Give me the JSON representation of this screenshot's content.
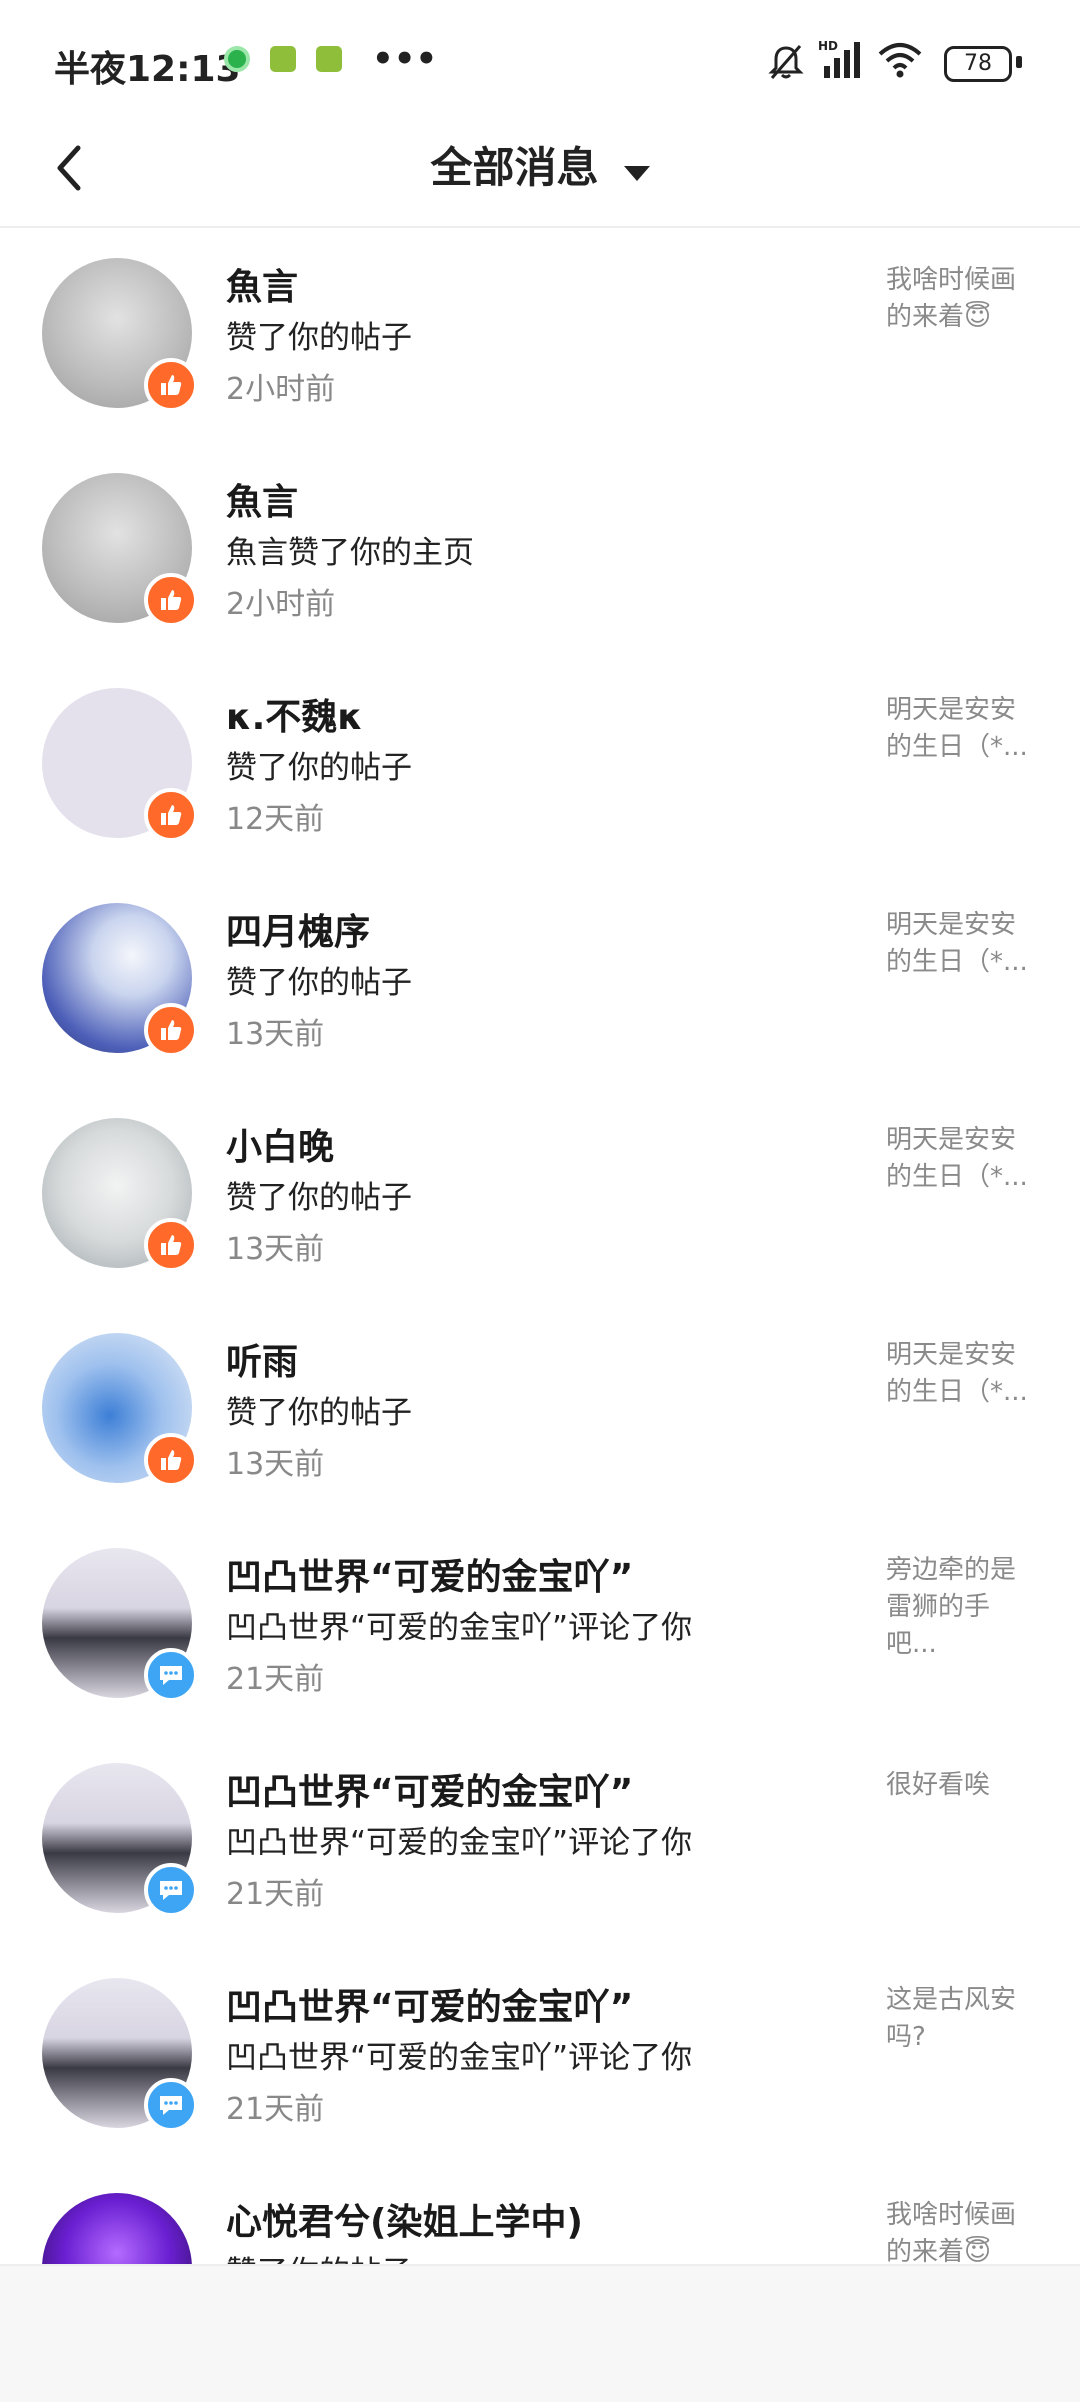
{
  "status_bar": {
    "time": "半夜12:13",
    "more": "•••",
    "battery": "78"
  },
  "header": {
    "title": "全部消息"
  },
  "messages": [
    {
      "name": "魚言",
      "action": "赞了你的帖子",
      "time": "2小时前",
      "preview": "我啥时候画的来着😇",
      "badge": "like-icon",
      "avatar": "sketch"
    },
    {
      "name": "魚言",
      "action": "魚言赞了你的主页",
      "time": "2小时前",
      "preview": "",
      "badge": "like-icon",
      "avatar": "sketch"
    },
    {
      "name": "κ.不魏κ",
      "action": "赞了你的帖子",
      "time": "12天前",
      "preview": "明天是安安的生日（*...",
      "badge": "like-icon",
      "avatar": "blank"
    },
    {
      "name": "四月槐序",
      "action": "赞了你的帖子",
      "time": "13天前",
      "preview": "明天是安安的生日（*...",
      "badge": "like-icon",
      "avatar": "blue-hair"
    },
    {
      "name": "小白晚",
      "action": "赞了你的帖子",
      "time": "13天前",
      "preview": "明天是安安的生日（*...",
      "badge": "like-icon",
      "avatar": "glasses"
    },
    {
      "name": "听雨",
      "action": "赞了你的帖子",
      "time": "13天前",
      "preview": "明天是安安的生日（*...",
      "badge": "like-icon",
      "avatar": "blue-outfit"
    },
    {
      "name": "凹凸世界“可爱的金宝吖”",
      "action": "凹凸世界“可爱的金宝吖”评论了你",
      "time": "21天前",
      "preview": "旁边牵的是雷狮的手吧...",
      "badge": "comment-icon",
      "avatar": "dark-coat"
    },
    {
      "name": "凹凸世界“可爱的金宝吖”",
      "action": "凹凸世界“可爱的金宝吖”评论了你",
      "time": "21天前",
      "preview": "很好看唉",
      "badge": "comment-icon",
      "avatar": "dark-coat"
    },
    {
      "name": "凹凸世界“可爱的金宝吖”",
      "action": "凹凸世界“可爱的金宝吖”评论了你",
      "time": "21天前",
      "preview": "这是古风安吗?",
      "badge": "comment-icon",
      "avatar": "dark-coat"
    },
    {
      "name": "心悦君兮(染姐上学中)",
      "action": "赞了你的帖子",
      "time": "",
      "preview": "我啥时候画的来着😇",
      "badge": "like-icon",
      "avatar": "purple"
    }
  ]
}
